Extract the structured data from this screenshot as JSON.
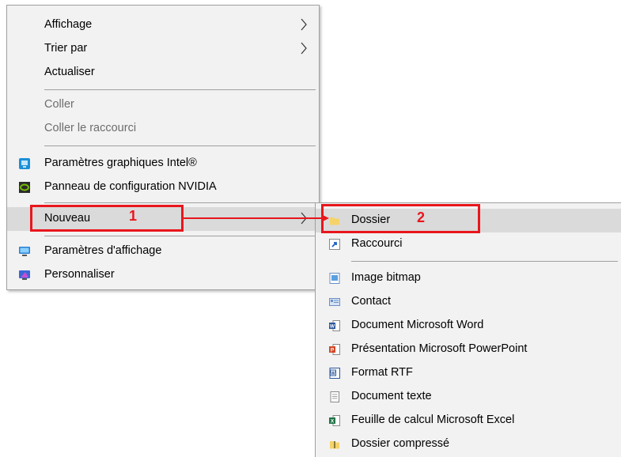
{
  "main_menu": {
    "items": [
      {
        "label": "Affichage"
      },
      {
        "label": "Trier par"
      },
      {
        "label": "Actualiser"
      },
      {
        "label": "Coller"
      },
      {
        "label": "Coller le raccourci"
      },
      {
        "label": "Paramètres graphiques Intel®"
      },
      {
        "label": "Panneau de configuration NVIDIA"
      },
      {
        "label": "Nouveau"
      },
      {
        "label": "Paramètres d'affichage"
      },
      {
        "label": "Personnaliser"
      }
    ]
  },
  "sub_menu": {
    "items": [
      {
        "label": "Dossier"
      },
      {
        "label": "Raccourci"
      },
      {
        "label": "Image bitmap"
      },
      {
        "label": "Contact"
      },
      {
        "label": "Document Microsoft Word"
      },
      {
        "label": "Présentation Microsoft PowerPoint"
      },
      {
        "label": "Format RTF"
      },
      {
        "label": "Document texte"
      },
      {
        "label": "Feuille de calcul Microsoft Excel"
      },
      {
        "label": "Dossier compressé"
      }
    ]
  },
  "annotations": {
    "step1": "1",
    "step2": "2",
    "color": "#e8161c"
  }
}
